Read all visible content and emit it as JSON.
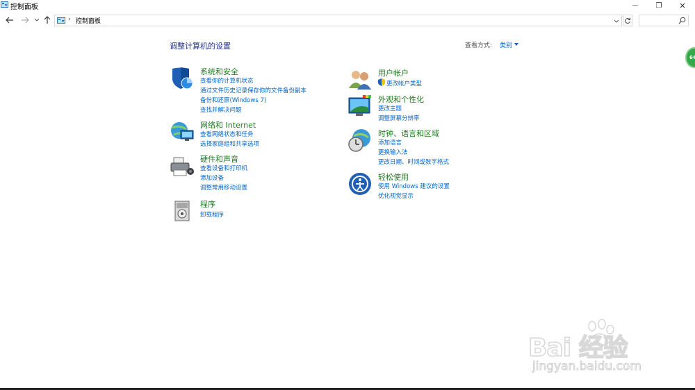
{
  "window": {
    "title": "控制面板",
    "minimize_glyph": "—",
    "restore_glyph": "❐",
    "close_glyph": "✕"
  },
  "address": {
    "separator": "›",
    "crumb": "控制面板",
    "search_placeholder": ""
  },
  "page": {
    "heading": "调整计算机的设置",
    "view_by_label": "查看方式:",
    "view_by_value": "类别"
  },
  "categories_left": [
    {
      "title": "系统和安全",
      "links": [
        "查看你的计算机状态",
        "通过文件历史记录保存你的文件备份副本",
        "备份和还原(Windows 7)",
        "查找并解决问题"
      ]
    },
    {
      "title": "网络和 Internet",
      "links": [
        "查看网络状态和任务",
        "选择家庭组和共享选项"
      ]
    },
    {
      "title": "硬件和声音",
      "links": [
        "查看设备和打印机",
        "添加设备",
        "调整常用移动设置"
      ]
    },
    {
      "title": "程序",
      "links": [
        "卸载程序"
      ]
    }
  ],
  "categories_right": [
    {
      "title": "用户帐户",
      "links": [
        "更改帐户类型"
      ]
    },
    {
      "title": "外观和个性化",
      "links": [
        "更改主题",
        "调整屏幕分辨率"
      ]
    },
    {
      "title": "时钟、语言和区域",
      "links": [
        "添加语言",
        "更换输入法",
        "更改日期、时间或数字格式"
      ]
    },
    {
      "title": "轻松使用",
      "links": [
        "使用 Windows 建议的设置",
        "优化视觉显示"
      ]
    }
  ],
  "side_badge": "64",
  "watermark": {
    "main": "Bai 经验",
    "sub": "jingyan.baidu.com"
  },
  "colors": {
    "heading": "#1e3287",
    "category_title": "#1f7a1f",
    "link": "#0066cc"
  }
}
